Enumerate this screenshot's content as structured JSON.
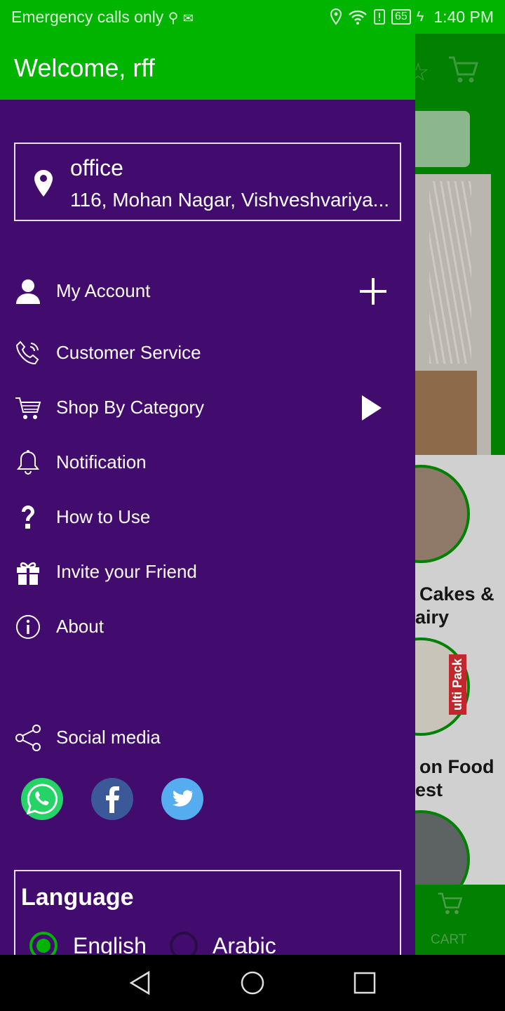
{
  "status_bar": {
    "carrier": "Emergency calls only",
    "battery": "65",
    "time": "1:40 PM"
  },
  "drawer": {
    "welcome": "Welcome, rff",
    "address": {
      "name": "office",
      "line": "116, Mohan Nagar, Vishveshvariya..."
    },
    "menu": [
      {
        "label": "My Account",
        "icon": "person-icon",
        "trailing": "plus-icon"
      },
      {
        "label": "Customer Service",
        "icon": "phone-icon"
      },
      {
        "label": "Shop By Category",
        "icon": "cart-icon",
        "trailing": "play-arrow-icon"
      },
      {
        "label": "Notification",
        "icon": "bell-icon"
      },
      {
        "label": "How to Use",
        "icon": "question-icon"
      },
      {
        "label": "Invite your Friend",
        "icon": "gift-icon"
      },
      {
        "label": "About",
        "icon": "info-icon"
      }
    ],
    "social_media_label": "Social media",
    "social": [
      {
        "name": "whatsapp",
        "color": "#25d366"
      },
      {
        "name": "facebook",
        "color": "#3b5998"
      },
      {
        "name": "twitter",
        "color": "#55acee"
      }
    ],
    "language": {
      "title": "Language",
      "options": [
        "English",
        "Arabic"
      ],
      "selected": "English"
    }
  },
  "background_app": {
    "category_label_1": "Cakes &",
    "category_label_1b": "airy",
    "category_label_2": "on Food",
    "category_label_2b": "est",
    "multi_pack_text": "ulti Pack",
    "bottom_tab_label": "CART"
  },
  "colors": {
    "brand_green": "#00b400",
    "drawer_purple": "#420b6e"
  }
}
